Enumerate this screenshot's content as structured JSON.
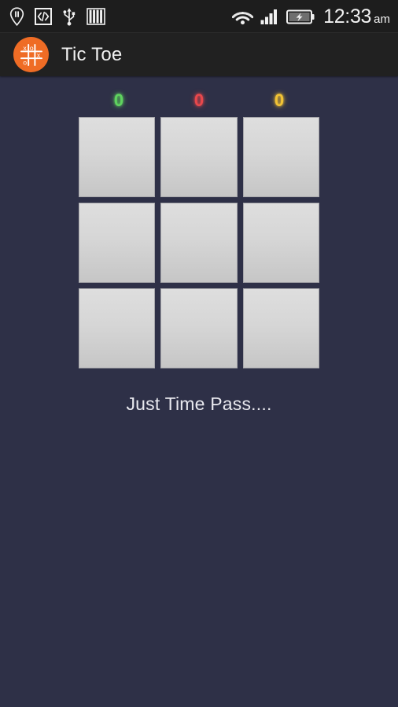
{
  "status_bar": {
    "notification_icons": [
      {
        "name": "pause-pin-icon",
        "glyph": "pause-pin"
      },
      {
        "name": "developer-code-icon",
        "glyph": "</>"
      },
      {
        "name": "usb-icon",
        "glyph": "usb"
      },
      {
        "name": "vertical-bars-icon",
        "glyph": "bars"
      }
    ],
    "system_icons": [
      {
        "name": "wifi-icon"
      },
      {
        "name": "cellular-signal-icon"
      },
      {
        "name": "battery-charging-icon"
      }
    ],
    "time": "12:33",
    "meridiem": "am",
    "background_color": "#1d1d1d"
  },
  "action_bar": {
    "title": "Tic Toe",
    "logo": {
      "name": "tic-toe-logo-icon",
      "background_color": "#ef6c25",
      "marks": [
        "x",
        "o",
        "o",
        "x"
      ]
    },
    "background_color": "#212121"
  },
  "game": {
    "scores": [
      {
        "label": "0",
        "color": "#5fd35f",
        "player": "player-one"
      },
      {
        "label": "0",
        "color": "#e8484c",
        "player": "player-two"
      },
      {
        "label": "0",
        "color": "#f2c335",
        "player": "draws"
      }
    ],
    "board": {
      "rows": 3,
      "columns": 3,
      "cells": [
        "",
        "",
        "",
        "",
        "",
        "",
        "",
        "",
        ""
      ]
    },
    "tagline": "Just Time Pass....",
    "background_color": "#2e3047"
  }
}
